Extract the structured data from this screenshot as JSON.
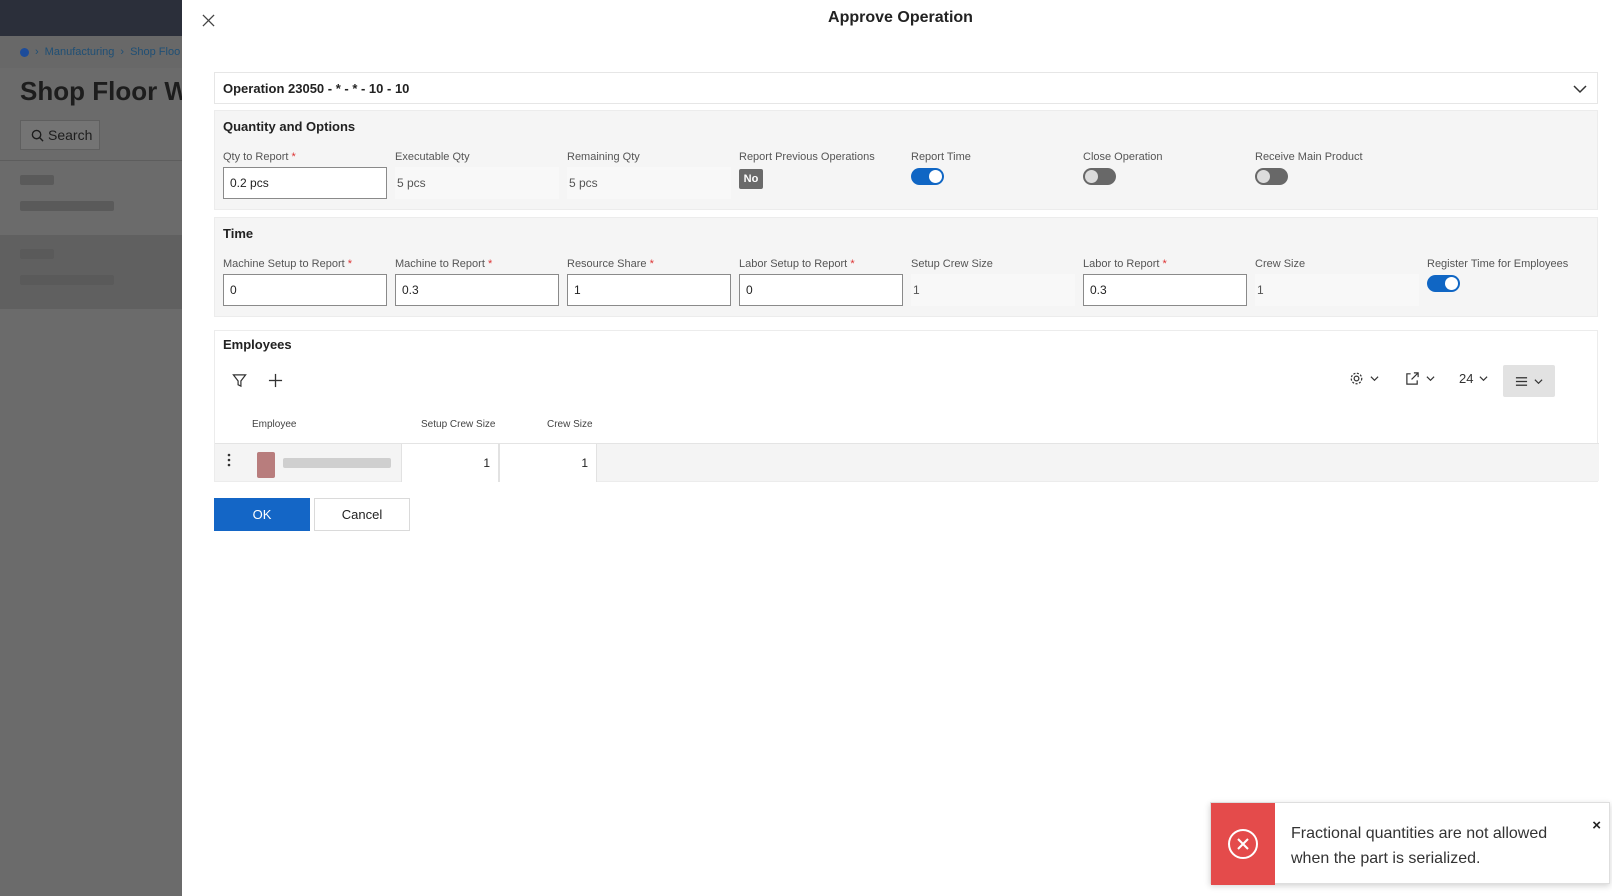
{
  "background": {
    "breadcrumb": [
      "Manufacturing",
      "Shop Floo"
    ],
    "page_title": "Shop Floor W",
    "search_label": "Search"
  },
  "dialog": {
    "title": "Approve Operation",
    "operation_header": "Operation 23050 - * - * - 10 - 10"
  },
  "quantity": {
    "section_title": "Quantity and Options",
    "qty_to_report": {
      "label": "Qty to Report",
      "value": "0.2 pcs",
      "required": "*"
    },
    "executable_qty": {
      "label": "Executable Qty",
      "value": "5 pcs"
    },
    "remaining_qty": {
      "label": "Remaining Qty",
      "value": "5 pcs"
    },
    "report_previous": {
      "label": "Report Previous Operations",
      "value": "No"
    },
    "report_time": {
      "label": "Report Time",
      "state": "on"
    },
    "close_operation": {
      "label": "Close Operation",
      "state": "off"
    },
    "receive_main_product": {
      "label": "Receive Main Product",
      "state": "off"
    }
  },
  "time": {
    "section_title": "Time",
    "machine_setup": {
      "label": "Machine Setup to Report",
      "value": "0",
      "required": "*"
    },
    "machine_to_report": {
      "label": "Machine to Report",
      "value": "0.3",
      "required": "*"
    },
    "resource_share": {
      "label": "Resource Share",
      "value": "1",
      "required": "*"
    },
    "labor_setup": {
      "label": "Labor Setup to Report",
      "value": "0",
      "required": "*"
    },
    "setup_crew_size": {
      "label": "Setup Crew Size",
      "value": "1"
    },
    "labor_to_report": {
      "label": "Labor to Report",
      "value": "0.3",
      "required": "*"
    },
    "crew_size": {
      "label": "Crew Size",
      "value": "1"
    },
    "register_time": {
      "label": "Register Time for Employees",
      "state": "on"
    }
  },
  "employees": {
    "section_title": "Employees",
    "page_size": "24",
    "columns": [
      "Employee",
      "Setup Crew Size",
      "Crew Size"
    ],
    "rows": [
      {
        "setup_crew_size": "1",
        "crew_size": "1"
      }
    ]
  },
  "buttons": {
    "ok": "OK",
    "cancel": "Cancel"
  },
  "toast": {
    "message": "Fractional quantities are not allowed when the part is serialized.",
    "close": "×"
  },
  "colors": {
    "primary": "#1466c6",
    "error": "#e44b4b",
    "toggle_on": "#1066c4"
  }
}
